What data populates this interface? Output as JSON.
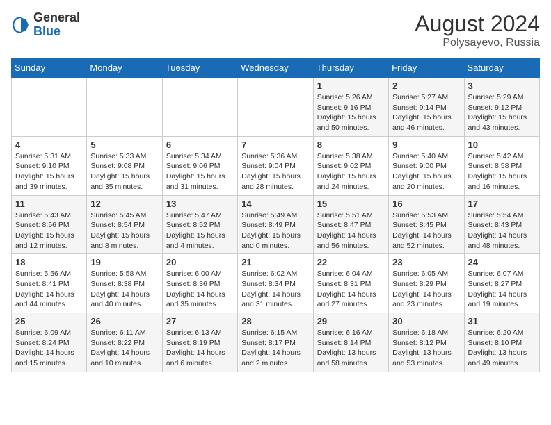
{
  "header": {
    "logo_general": "General",
    "logo_blue": "Blue",
    "month_year": "August 2024",
    "location": "Polysayevo, Russia"
  },
  "days_of_week": [
    "Sunday",
    "Monday",
    "Tuesday",
    "Wednesday",
    "Thursday",
    "Friday",
    "Saturday"
  ],
  "weeks": [
    [
      {
        "day": "",
        "info": ""
      },
      {
        "day": "",
        "info": ""
      },
      {
        "day": "",
        "info": ""
      },
      {
        "day": "",
        "info": ""
      },
      {
        "day": "1",
        "info": "Sunrise: 5:26 AM\nSunset: 9:16 PM\nDaylight: 15 hours\nand 50 minutes."
      },
      {
        "day": "2",
        "info": "Sunrise: 5:27 AM\nSunset: 9:14 PM\nDaylight: 15 hours\nand 46 minutes."
      },
      {
        "day": "3",
        "info": "Sunrise: 5:29 AM\nSunset: 9:12 PM\nDaylight: 15 hours\nand 43 minutes."
      }
    ],
    [
      {
        "day": "4",
        "info": "Sunrise: 5:31 AM\nSunset: 9:10 PM\nDaylight: 15 hours\nand 39 minutes."
      },
      {
        "day": "5",
        "info": "Sunrise: 5:33 AM\nSunset: 9:08 PM\nDaylight: 15 hours\nand 35 minutes."
      },
      {
        "day": "6",
        "info": "Sunrise: 5:34 AM\nSunset: 9:06 PM\nDaylight: 15 hours\nand 31 minutes."
      },
      {
        "day": "7",
        "info": "Sunrise: 5:36 AM\nSunset: 9:04 PM\nDaylight: 15 hours\nand 28 minutes."
      },
      {
        "day": "8",
        "info": "Sunrise: 5:38 AM\nSunset: 9:02 PM\nDaylight: 15 hours\nand 24 minutes."
      },
      {
        "day": "9",
        "info": "Sunrise: 5:40 AM\nSunset: 9:00 PM\nDaylight: 15 hours\nand 20 minutes."
      },
      {
        "day": "10",
        "info": "Sunrise: 5:42 AM\nSunset: 8:58 PM\nDaylight: 15 hours\nand 16 minutes."
      }
    ],
    [
      {
        "day": "11",
        "info": "Sunrise: 5:43 AM\nSunset: 8:56 PM\nDaylight: 15 hours\nand 12 minutes."
      },
      {
        "day": "12",
        "info": "Sunrise: 5:45 AM\nSunset: 8:54 PM\nDaylight: 15 hours\nand 8 minutes."
      },
      {
        "day": "13",
        "info": "Sunrise: 5:47 AM\nSunset: 8:52 PM\nDaylight: 15 hours\nand 4 minutes."
      },
      {
        "day": "14",
        "info": "Sunrise: 5:49 AM\nSunset: 8:49 PM\nDaylight: 15 hours\nand 0 minutes."
      },
      {
        "day": "15",
        "info": "Sunrise: 5:51 AM\nSunset: 8:47 PM\nDaylight: 14 hours\nand 56 minutes."
      },
      {
        "day": "16",
        "info": "Sunrise: 5:53 AM\nSunset: 8:45 PM\nDaylight: 14 hours\nand 52 minutes."
      },
      {
        "day": "17",
        "info": "Sunrise: 5:54 AM\nSunset: 8:43 PM\nDaylight: 14 hours\nand 48 minutes."
      }
    ],
    [
      {
        "day": "18",
        "info": "Sunrise: 5:56 AM\nSunset: 8:41 PM\nDaylight: 14 hours\nand 44 minutes."
      },
      {
        "day": "19",
        "info": "Sunrise: 5:58 AM\nSunset: 8:38 PM\nDaylight: 14 hours\nand 40 minutes."
      },
      {
        "day": "20",
        "info": "Sunrise: 6:00 AM\nSunset: 8:36 PM\nDaylight: 14 hours\nand 35 minutes."
      },
      {
        "day": "21",
        "info": "Sunrise: 6:02 AM\nSunset: 8:34 PM\nDaylight: 14 hours\nand 31 minutes."
      },
      {
        "day": "22",
        "info": "Sunrise: 6:04 AM\nSunset: 8:31 PM\nDaylight: 14 hours\nand 27 minutes."
      },
      {
        "day": "23",
        "info": "Sunrise: 6:05 AM\nSunset: 8:29 PM\nDaylight: 14 hours\nand 23 minutes."
      },
      {
        "day": "24",
        "info": "Sunrise: 6:07 AM\nSunset: 8:27 PM\nDaylight: 14 hours\nand 19 minutes."
      }
    ],
    [
      {
        "day": "25",
        "info": "Sunrise: 6:09 AM\nSunset: 8:24 PM\nDaylight: 14 hours\nand 15 minutes."
      },
      {
        "day": "26",
        "info": "Sunrise: 6:11 AM\nSunset: 8:22 PM\nDaylight: 14 hours\nand 10 minutes."
      },
      {
        "day": "27",
        "info": "Sunrise: 6:13 AM\nSunset: 8:19 PM\nDaylight: 14 hours\nand 6 minutes."
      },
      {
        "day": "28",
        "info": "Sunrise: 6:15 AM\nSunset: 8:17 PM\nDaylight: 14 hours\nand 2 minutes."
      },
      {
        "day": "29",
        "info": "Sunrise: 6:16 AM\nSunset: 8:14 PM\nDaylight: 13 hours\nand 58 minutes."
      },
      {
        "day": "30",
        "info": "Sunrise: 6:18 AM\nSunset: 8:12 PM\nDaylight: 13 hours\nand 53 minutes."
      },
      {
        "day": "31",
        "info": "Sunrise: 6:20 AM\nSunset: 8:10 PM\nDaylight: 13 hours\nand 49 minutes."
      }
    ]
  ]
}
